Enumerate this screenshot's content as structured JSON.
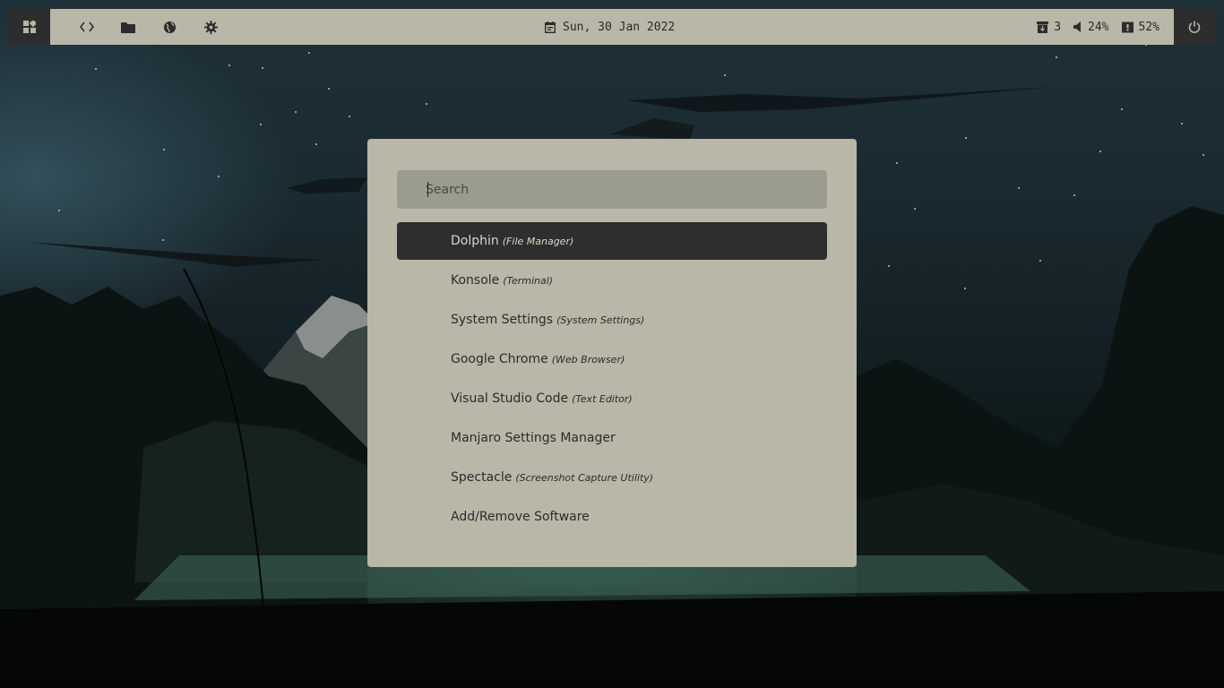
{
  "colors": {
    "bar_bg": "#b8b7a8",
    "bar_dark": "#2d2d2d",
    "launcher_bg": "#b8b7a8",
    "search_bg": "#9c9b8f",
    "active_item_bg": "#2e2e2e"
  },
  "topbar": {
    "launcher_icon": "apps-grid-icon",
    "left_icons": [
      {
        "name": "code-icon"
      },
      {
        "name": "folder-icon"
      },
      {
        "name": "globe-icon"
      },
      {
        "name": "gear-icon"
      }
    ],
    "date": "Sun, 30 Jan 2022",
    "updates": "3",
    "volume": "24%",
    "battery": "52%",
    "power_icon": "power-icon"
  },
  "launcher": {
    "search_placeholder": "Search",
    "search_value": "",
    "items": [
      {
        "name": "Dolphin",
        "desc": "(File Manager)",
        "active": true
      },
      {
        "name": "Konsole",
        "desc": "(Terminal)"
      },
      {
        "name": "System Settings",
        "desc": "(System Settings)"
      },
      {
        "name": "Google Chrome",
        "desc": "(Web Browser)"
      },
      {
        "name": "Visual Studio Code",
        "desc": "(Text Editor)"
      },
      {
        "name": "Manjaro Settings Manager",
        "desc": ""
      },
      {
        "name": "Spectacle",
        "desc": "(Screenshot Capture Utility)"
      },
      {
        "name": "Add/Remove Software",
        "desc": ""
      }
    ]
  }
}
